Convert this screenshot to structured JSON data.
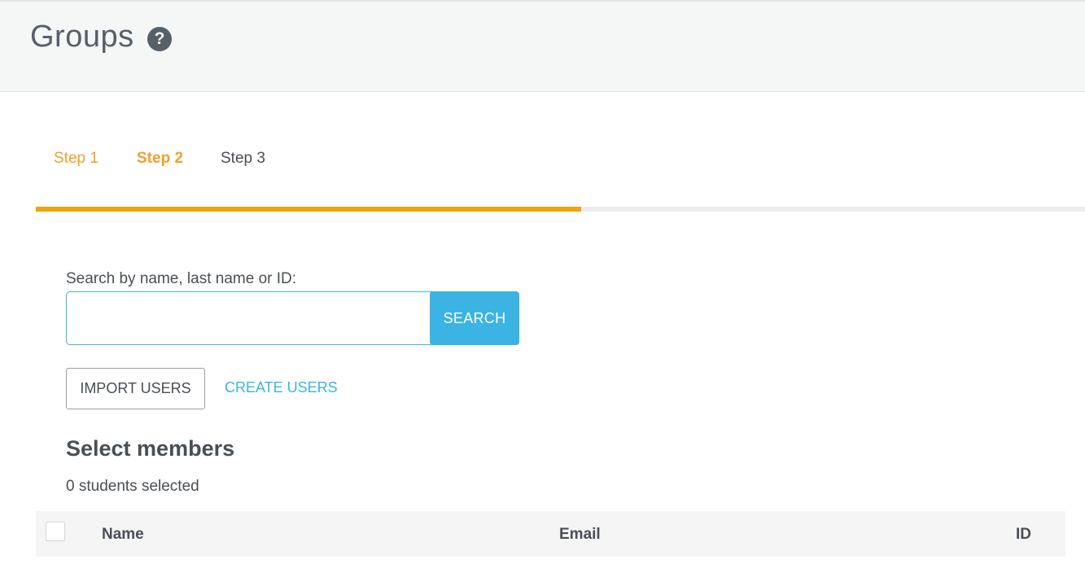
{
  "header": {
    "title": "Groups",
    "help_icon": "question-circle-icon",
    "help_glyph": "?"
  },
  "steps": {
    "items": [
      {
        "label": "Step 1",
        "state": "completed"
      },
      {
        "label": "Step 2",
        "state": "active"
      },
      {
        "label": "Step 3",
        "state": "upcoming"
      }
    ],
    "progress_fraction": 0.52,
    "accent_color": "#f0a30a"
  },
  "search": {
    "label": "Search by name, last name or ID:",
    "value": "",
    "placeholder": "",
    "button_label": "SEARCH"
  },
  "actions": {
    "import_label": "IMPORT USERS",
    "create_label": "CREATE USERS"
  },
  "members": {
    "title": "Select members",
    "selected_count_text": "0 students selected"
  },
  "table": {
    "columns": [
      "Name",
      "Email",
      "ID"
    ],
    "rows": []
  },
  "colors": {
    "primary_blue": "#3cb4e3",
    "step_orange": "#f0a030",
    "text_dark": "#4a4f55"
  }
}
